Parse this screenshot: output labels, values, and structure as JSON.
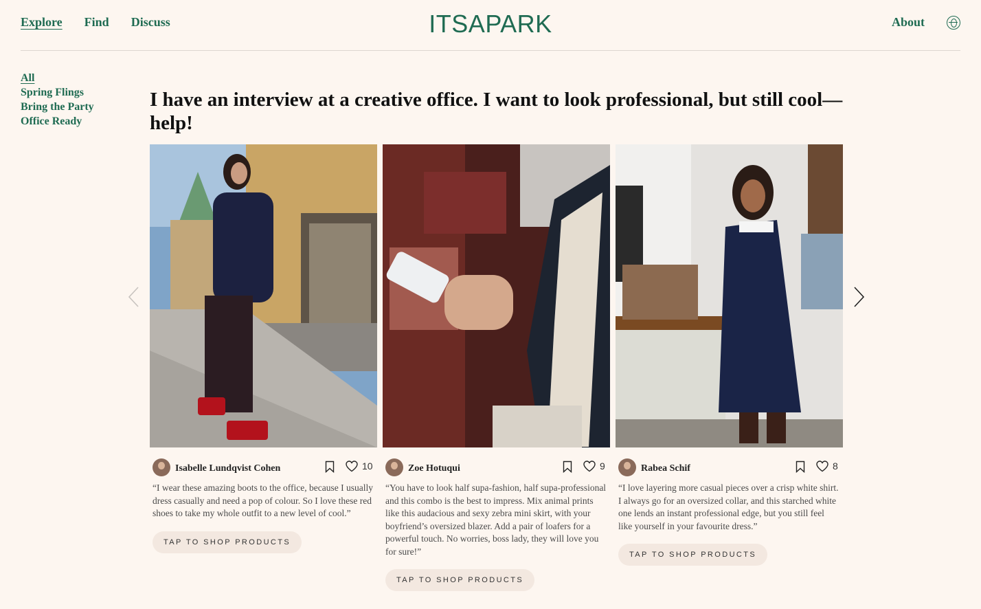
{
  "nav": {
    "left": [
      "Explore",
      "Find",
      "Discuss"
    ],
    "logo": "ITSAPARK",
    "about": "About",
    "language_icon": "globe-icon"
  },
  "sidebar": {
    "items": [
      "All",
      "Spring Flings",
      "Bring the Party",
      "Office Ready"
    ]
  },
  "headline": "I have an interview at a creative office. I want to look professional, but still cool—help!",
  "carousel": {
    "prev_icon": "chevron-left-icon",
    "next_icon": "chevron-right-icon"
  },
  "cards": [
    {
      "author": "Isabelle Lundqvist Cohen",
      "likes": "10",
      "quote": "“I wear these amazing boots to the office, because I usually dress casually and need a pop of colour. So I love these red shoes to take my whole outfit to a new level of cool.”",
      "cta": "TAP TO SHOP PRODUCTS"
    },
    {
      "author": "Zoe Hotuqui",
      "likes": "9",
      "quote": "“You have to look half supa-fashion, half supa-professional and this combo is the best to impress. Mix animal prints like this audacious and sexy zebra mini skirt, with your boyfriend’s oversized blazer. Add a pair of loafers for a powerful touch. No worries, boss lady, they will love you for sure!”",
      "cta": "TAP TO SHOP PRODUCTS"
    },
    {
      "author": "Rabea Schif",
      "likes": "8",
      "quote": "“I love layering more casual pieces over a crisp white shirt. I always go for an oversized collar, and this starched white one lends an instant professional edge, but you still feel like yourself in your favourite dress.”",
      "cta": "TAP TO SHOP PRODUCTS"
    }
  ]
}
